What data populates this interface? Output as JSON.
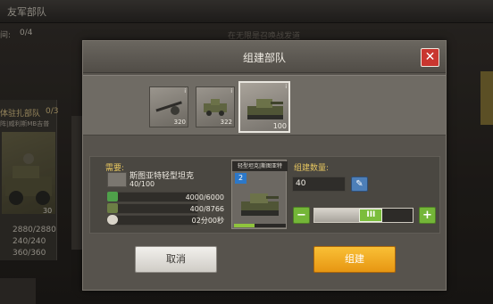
{
  "background": {
    "title": "友军部队",
    "count_label": "间:",
    "count_value": "0/4",
    "hint": "在无限是召唤战发道",
    "unit_title": "体驻扎部队",
    "unit_count": "0/3",
    "unit_subtitle": "阵|威利斯MB吉普",
    "unit_number": "30",
    "stats": [
      "2880/2880",
      "240/240",
      "360/360"
    ]
  },
  "dialog": {
    "title": "组建部队",
    "close_label": "✕",
    "parts": [
      {
        "name": "rifle",
        "count": "320"
      },
      {
        "name": "armored-car",
        "count": "322"
      },
      {
        "name": "light-tank",
        "count": "100"
      }
    ],
    "requirement": {
      "label": "需要:",
      "unit_name": "斯图亚特轻型坦克",
      "unit_count": "40/100"
    },
    "resources": [
      {
        "icon": "cash-icon",
        "color": "#4fa04a",
        "value": "4000/6000"
      },
      {
        "icon": "oil-icon",
        "color": "#6c7e45",
        "value": "400/8766"
      },
      {
        "icon": "timer-icon",
        "color": "#d9d4c9",
        "value": "02分00秒"
      }
    ],
    "unit_card": {
      "title": "轻型坦克|斯图亚特",
      "level": "2",
      "progress": 0.4
    },
    "quantity": {
      "label": "组建数量:",
      "value": "40",
      "edit_icon": "pencil-icon",
      "minus_label": "−",
      "plus_label": "+",
      "slider_fraction": 0.6,
      "slider_thumb_label": "III"
    },
    "cancel_label": "取消",
    "build_label": "组建"
  }
}
